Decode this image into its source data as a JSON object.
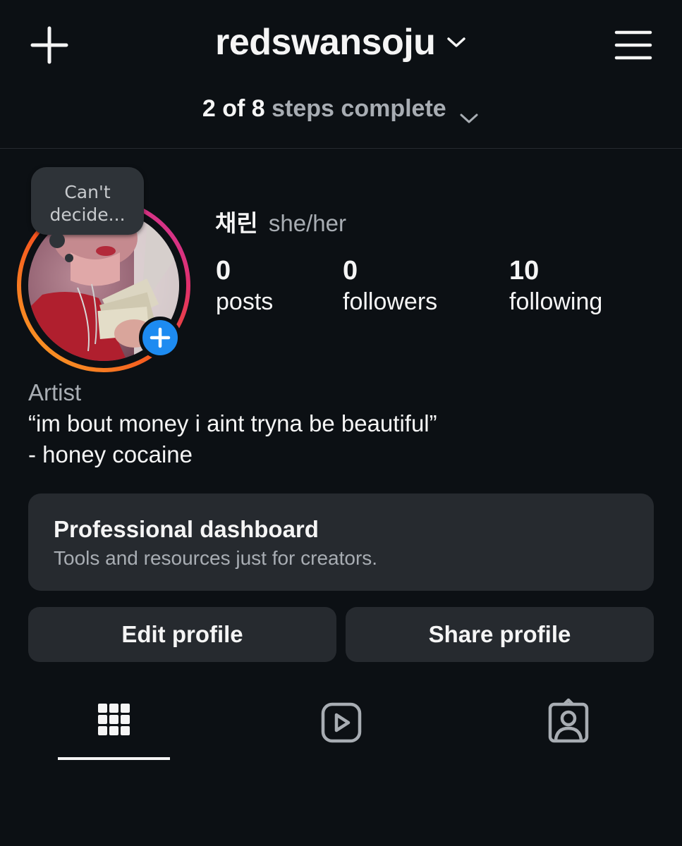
{
  "header": {
    "username": "redswansoju",
    "steps_count": "2 of 8",
    "steps_text": "steps complete"
  },
  "profile": {
    "note": "Can't decide...",
    "display_name": "채린",
    "pronouns": "she/her",
    "stats": [
      {
        "value": "0",
        "label": "posts"
      },
      {
        "value": "0",
        "label": "followers"
      },
      {
        "value": "10",
        "label": "following"
      }
    ],
    "bio": {
      "category": "Artist",
      "line1": "“im bout money i aint tryna be beautiful”",
      "line2": "- honey cocaine"
    }
  },
  "dashboard": {
    "title": "Professional dashboard",
    "subtitle": "Tools and resources just for creators."
  },
  "actions": {
    "edit": "Edit profile",
    "share": "Share profile"
  },
  "tabs": [
    {
      "icon": "grid-icon",
      "active": true
    },
    {
      "icon": "reels-icon",
      "active": false
    },
    {
      "icon": "tagged-icon",
      "active": false
    }
  ],
  "colors": {
    "background": "#0c1014",
    "card": "#262a2f",
    "accent_blue": "#1d8bf1",
    "ring_gradient": [
      "#f9a825",
      "#f5541f",
      "#e1306c",
      "#c837ab"
    ]
  }
}
